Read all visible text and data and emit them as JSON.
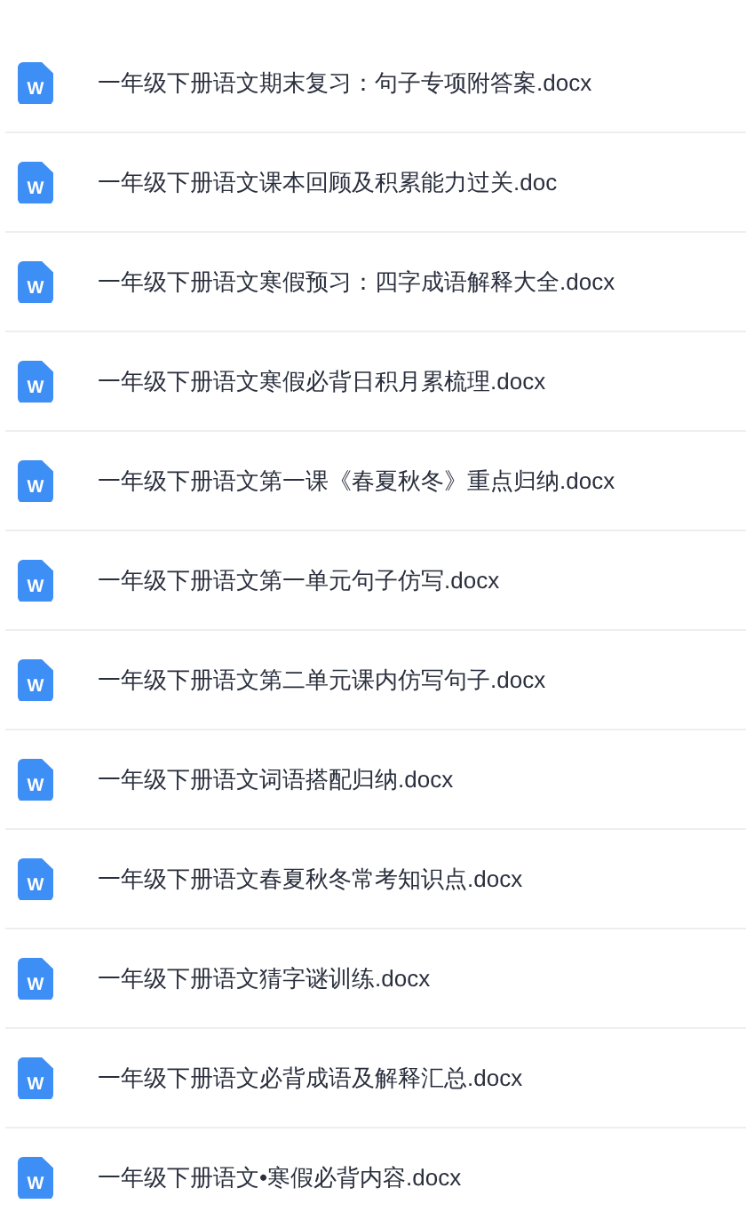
{
  "files": [
    {
      "name": "一年级下册语文期末复习：句子专项附答案.docx",
      "icon_label": "W"
    },
    {
      "name": "一年级下册语文课本回顾及积累能力过关.doc",
      "icon_label": "W"
    },
    {
      "name": "一年级下册语文寒假预习：四字成语解释大全.docx",
      "icon_label": "W"
    },
    {
      "name": "一年级下册语文寒假必背日积月累梳理.docx",
      "icon_label": "W"
    },
    {
      "name": "一年级下册语文第一课《春夏秋冬》重点归纳.docx",
      "icon_label": "W"
    },
    {
      "name": "一年级下册语文第一单元句子仿写.docx",
      "icon_label": "W"
    },
    {
      "name": "一年级下册语文第二单元课内仿写句子.docx",
      "icon_label": "W"
    },
    {
      "name": "一年级下册语文词语搭配归纳.docx",
      "icon_label": "W"
    },
    {
      "name": "一年级下册语文春夏秋冬常考知识点.docx",
      "icon_label": "W"
    },
    {
      "name": "一年级下册语文猜字谜训练.docx",
      "icon_label": "W"
    },
    {
      "name": "一年级下册语文必背成语及解释汇总.docx",
      "icon_label": "W"
    },
    {
      "name": "一年级下册语文•寒假必背内容.docx",
      "icon_label": "W"
    }
  ]
}
